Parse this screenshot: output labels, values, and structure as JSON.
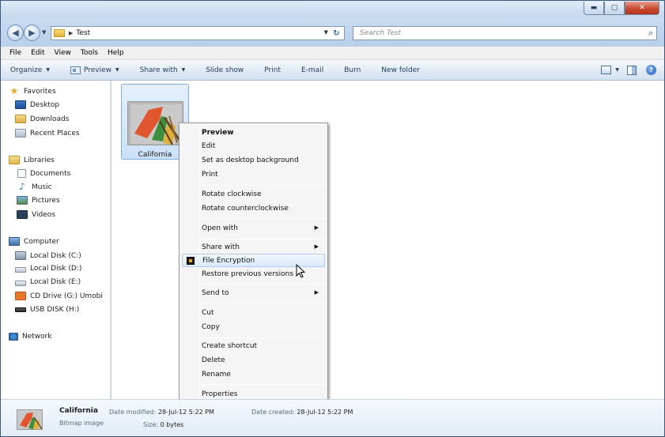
{
  "window": {
    "caption_buttons": [
      "minimize",
      "maximize",
      "close"
    ]
  },
  "address": {
    "path": "Test",
    "search_placeholder": "Search Test"
  },
  "menubar": [
    "File",
    "Edit",
    "View",
    "Tools",
    "Help"
  ],
  "commandbar": {
    "organize": "Organize",
    "preview": "Preview",
    "share_with": "Share with",
    "slide_show": "Slide show",
    "print": "Print",
    "email": "E-mail",
    "burn": "Burn",
    "new_folder": "New folder"
  },
  "navpane": {
    "favorites": "Favorites",
    "desktop": "Desktop",
    "downloads": "Downloads",
    "recent_places": "Recent Places",
    "libraries": "Libraries",
    "documents": "Documents",
    "music": "Music",
    "pictures": "Pictures",
    "videos": "Videos",
    "computer": "Computer",
    "local_c": "Local Disk (C:)",
    "local_d": "Local Disk (D:)",
    "local_e": "Local Disk (E:)",
    "cd_drive": "CD Drive (G:) Umobi",
    "usb": "USB DISK (H:)",
    "network": "Network"
  },
  "file": {
    "name": "California"
  },
  "context_menu": {
    "preview": "Preview",
    "edit": "Edit",
    "set_background": "Set as desktop background",
    "print": "Print",
    "rotate_cw": "Rotate clockwise",
    "rotate_ccw": "Rotate counterclockwise",
    "open_with": "Open with",
    "share_with": "Share with",
    "file_encryption": "File Encryption",
    "restore": "Restore previous versions",
    "send_to": "Send to",
    "cut": "Cut",
    "copy": "Copy",
    "create_shortcut": "Create shortcut",
    "delete": "Delete",
    "rename": "Rename",
    "properties": "Properties"
  },
  "details": {
    "name": "California",
    "type": "Bitmap image",
    "date_modified_label": "Date modified:",
    "date_modified": "28-Jul-12 5:22 PM",
    "size_label": "Size:",
    "size": "0 bytes",
    "date_created_label": "Date created:",
    "date_created": "28-Jul-12 5:22 PM"
  }
}
